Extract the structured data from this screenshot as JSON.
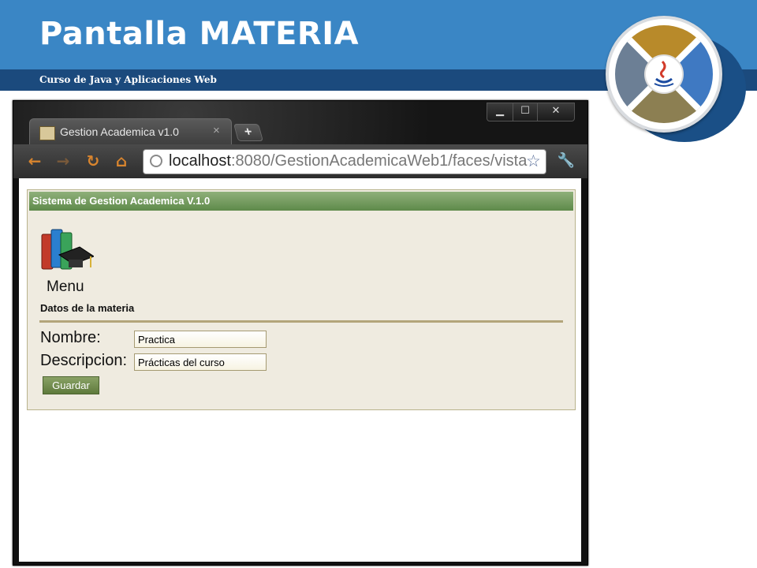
{
  "slide": {
    "title": "Pantalla MATERIA",
    "subtitle": "Curso de Java y Aplicaciones Web"
  },
  "browser": {
    "tab_title": "Gestion Academica v1.0",
    "tab_close": "×",
    "new_tab": "+",
    "url_host": "localhost",
    "url_rest": ":8080/GestionAcademicaWeb1/faces/vista",
    "window_controls": {
      "minimize": "▁",
      "maximize": "☐",
      "close": "✕"
    },
    "nav": {
      "back": "←",
      "forward": "→",
      "reload": "↻",
      "home": "⌂",
      "bookmark": "☆",
      "wrench": "🔧"
    }
  },
  "app": {
    "header": "Sistema de Gestion Academica V.1.0",
    "menu_label": "Menu",
    "section_title": "Datos de la materia",
    "fields": {
      "nombre_label": "Nombre:",
      "nombre_value": "Practica",
      "descripcion_label": "Descripcion:",
      "descripcion_value": "Prácticas del curso"
    },
    "save_label": "Guardar"
  },
  "colors": {
    "header_blue": "#3a86c5",
    "band_navy": "#1b4a7d",
    "panel_header_green": "#6f9a58",
    "panel_bg": "#efebe0"
  },
  "icons": [
    "java-logo-icon",
    "books-icon",
    "globe-icon",
    "star-icon",
    "wrench-icon",
    "favicon-icon"
  ]
}
